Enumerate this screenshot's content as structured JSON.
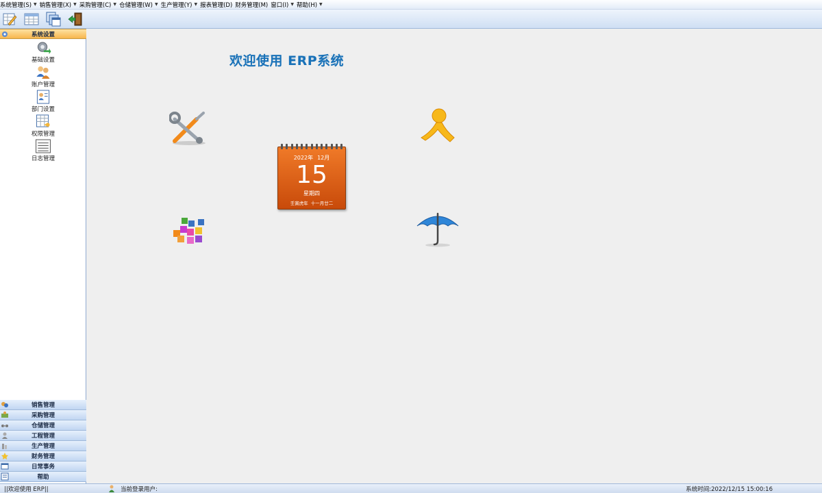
{
  "menu": {
    "items": [
      {
        "label": "系统管理(S)",
        "icon": "caret-down-icon"
      },
      {
        "label": "销售管理(X)",
        "icon": "caret-down-icon"
      },
      {
        "label": "采购管理(C)",
        "icon": "caret-down-icon"
      },
      {
        "label": "仓储管理(W)",
        "icon": "caret-down-icon"
      },
      {
        "label": "生产管理(Y)",
        "icon": "caret-down-icon"
      },
      {
        "label": "报表管理(D)",
        "icon": ""
      },
      {
        "label": "财务管理(M)",
        "icon": ""
      },
      {
        "label": "窗口(I)",
        "icon": "caret-down-icon"
      },
      {
        "label": "帮助(H)",
        "icon": "caret-down-icon"
      }
    ]
  },
  "toolbar": {
    "buttons": [
      "edit-sheet-icon",
      "calendar-grid-icon",
      "copy-windows-icon",
      "exit-door-icon"
    ]
  },
  "sidebar": {
    "active_group": {
      "label": "系统设置",
      "icon": "settings-group-icon"
    },
    "items": [
      {
        "label": "基础设置",
        "icon": "gear-arrow-icon"
      },
      {
        "label": "账户管理",
        "icon": "users-icon"
      },
      {
        "label": "部门设置",
        "icon": "department-icon"
      },
      {
        "label": "权限管理",
        "icon": "permission-icon"
      },
      {
        "label": "日志管理",
        "icon": "log-icon"
      }
    ],
    "groups": [
      {
        "label": "销售管理",
        "icon": "sales-icon"
      },
      {
        "label": "采购管理",
        "icon": "purchase-icon"
      },
      {
        "label": "仓储管理",
        "icon": "warehouse-icon"
      },
      {
        "label": "工程管理",
        "icon": "engineering-icon"
      },
      {
        "label": "生产管理",
        "icon": "production-icon"
      },
      {
        "label": "财务管理",
        "icon": "finance-icon"
      },
      {
        "label": "日常事务",
        "icon": "daily-icon"
      },
      {
        "label": "帮助",
        "icon": "help-icon"
      }
    ]
  },
  "main": {
    "welcome_title": "欢迎使用    ERP系统",
    "calendar": {
      "year": "2022年",
      "month": "12月",
      "day": "15",
      "weekday": "星期四",
      "lunar_year": "壬寅虎年",
      "lunar_date": "十一月廿二"
    },
    "icons": [
      "tools-icon",
      "runner-icon",
      "blocks-icon",
      "umbrella-icon"
    ]
  },
  "statusbar": {
    "welcome": "||欢迎使用      ERP||",
    "user_label": "当前登录用户:",
    "time": "系统时间:2022/12/15 15:00:16"
  },
  "colors": {
    "accent_blue": "#1a72b8",
    "active_group": "#f8b64c",
    "calendar": "#e0621a"
  }
}
